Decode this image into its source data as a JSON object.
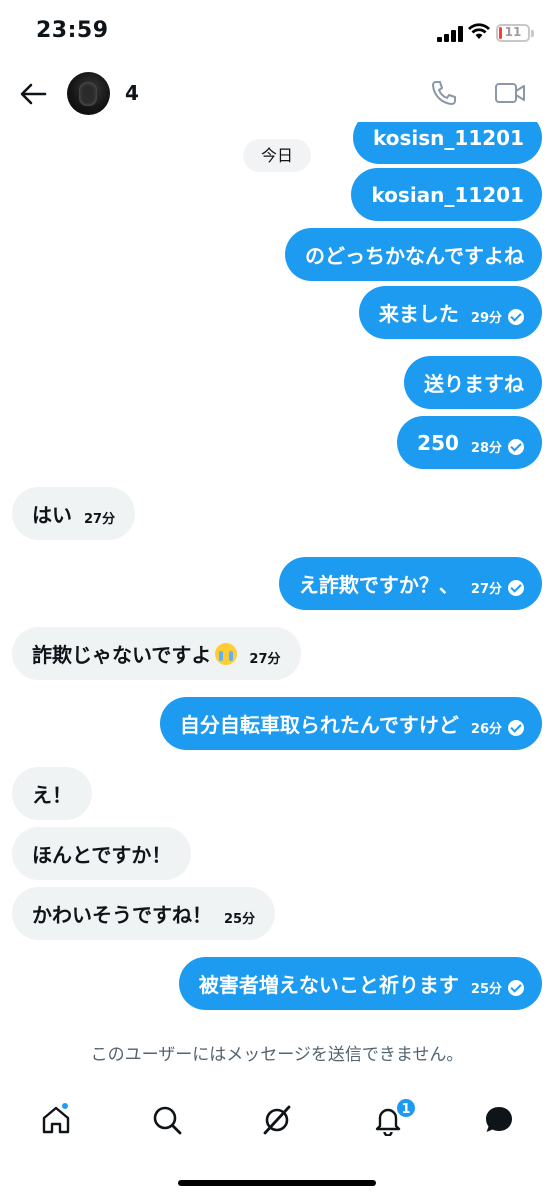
{
  "status_bar": {
    "time": "23:59",
    "battery": "11",
    "battery_level_percent": 11
  },
  "header": {
    "contact_name": "4"
  },
  "chat": {
    "date_label": "今日",
    "messages": [
      {
        "direction": "out",
        "text": "kosisn_11201",
        "time": "",
        "read": false
      },
      {
        "direction": "out",
        "text": "kosian_11201",
        "time": "",
        "read": false
      },
      {
        "direction": "out",
        "text": "のどっちかなんですよね",
        "time": "",
        "read": false
      },
      {
        "direction": "out",
        "text": "来ました",
        "time": "29分",
        "read": true
      },
      {
        "direction": "out",
        "text": "送りますね",
        "time": "",
        "read": false
      },
      {
        "direction": "out",
        "text": "250",
        "time": "28分",
        "read": true
      },
      {
        "direction": "in",
        "text": "はい",
        "time": "27分"
      },
      {
        "direction": "out",
        "text": "え詐欺ですか？、",
        "time": "27分",
        "read": true
      },
      {
        "direction": "in",
        "text": "詐欺じゃないですよ",
        "time": "27分",
        "emoji": "crying-face"
      },
      {
        "direction": "out",
        "text": "自分自転車取られたんですけど",
        "time": "26分",
        "read": true
      },
      {
        "direction": "in",
        "text": "え！",
        "time": ""
      },
      {
        "direction": "in",
        "text": "ほんとですか！",
        "time": ""
      },
      {
        "direction": "in",
        "text": "かわいそうですね！",
        "time": "25分"
      },
      {
        "direction": "out",
        "text": "被害者増えないこと祈ります",
        "time": "25分",
        "read": true
      }
    ]
  },
  "notice": "このユーザーにはメッセージを送信できません。",
  "tab_bar": {
    "tabs": [
      "home-icon",
      "search-icon",
      "grok-icon",
      "bell-icon",
      "messages-icon"
    ],
    "notification_count": "1"
  },
  "colors": {
    "accent": "#1d9bf0",
    "incoming_bubble": "#eff3f4",
    "text": "#0f1419",
    "muted": "#536471"
  }
}
